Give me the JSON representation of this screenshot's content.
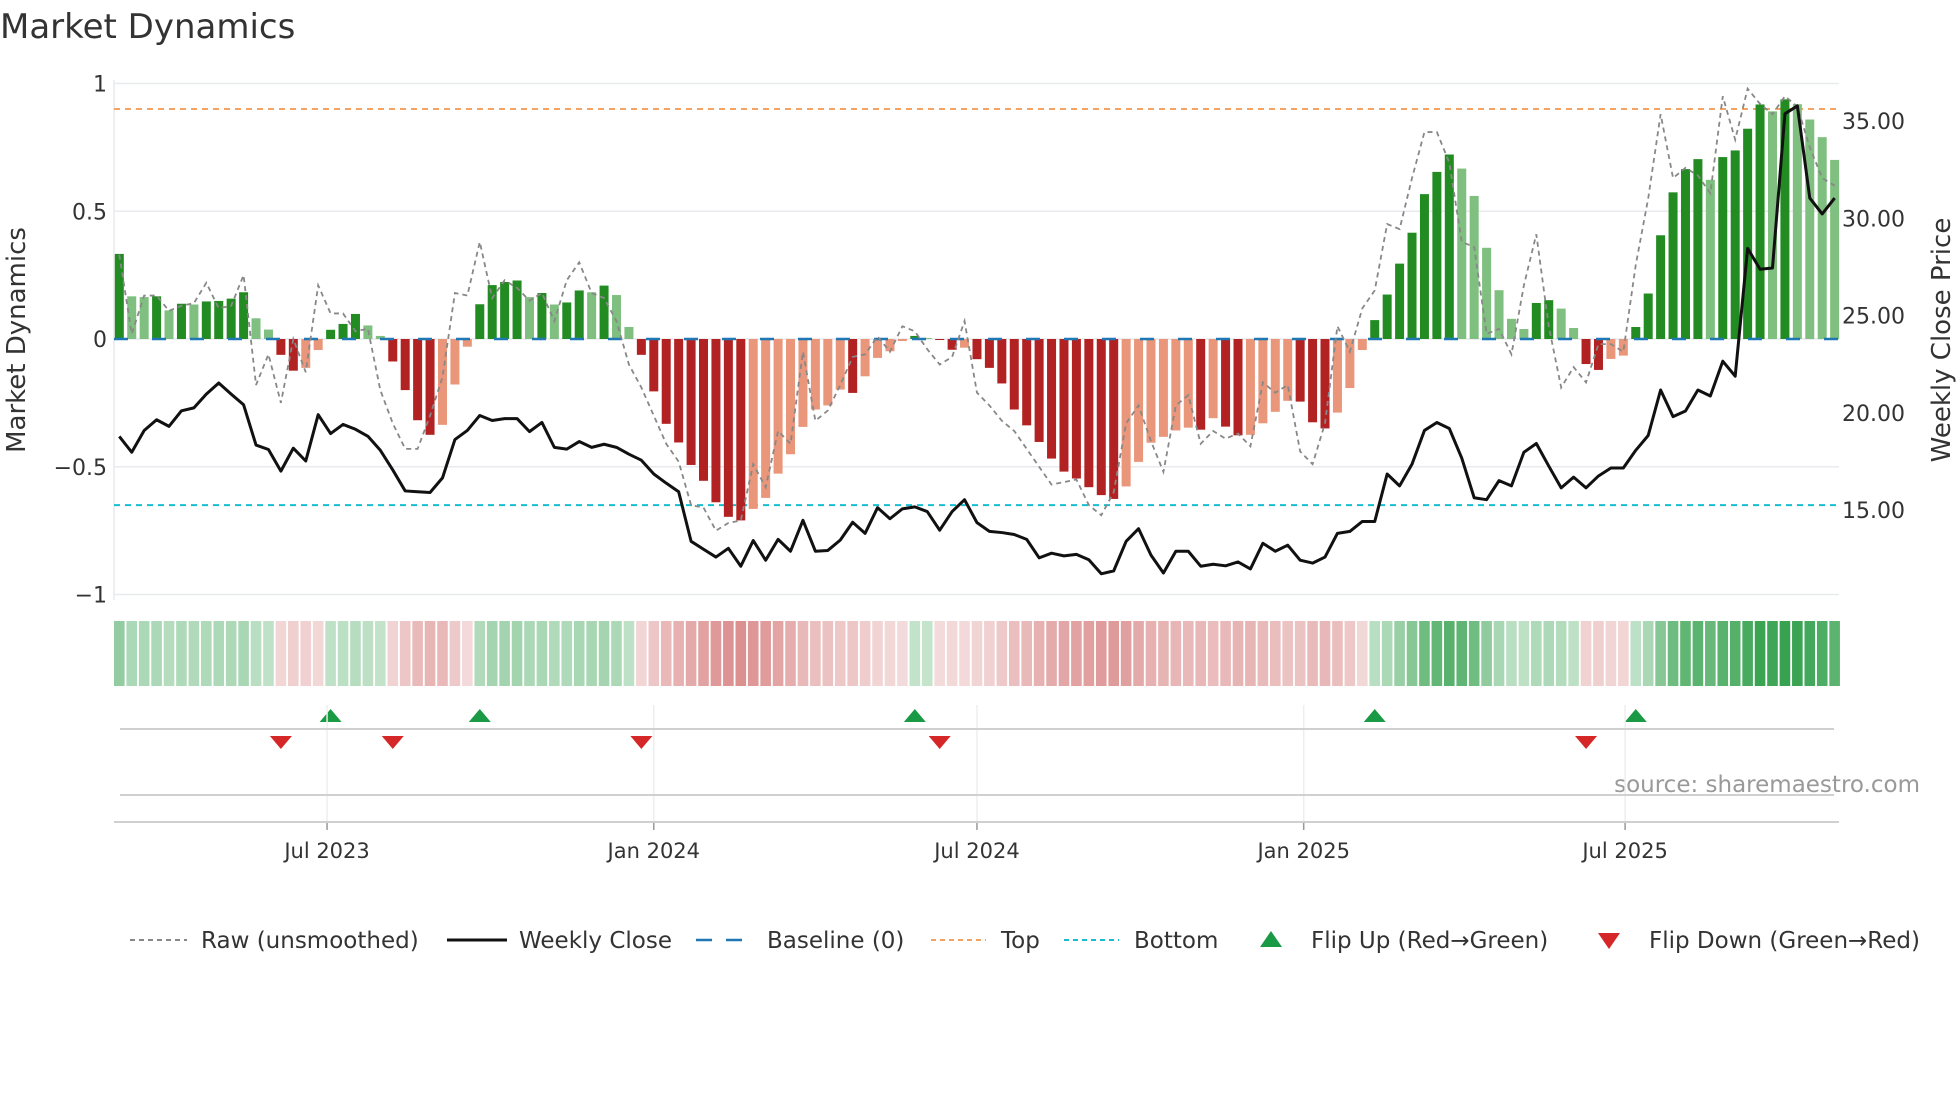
{
  "chart_data": {
    "type": "bar",
    "title": "Market Dynamics",
    "ylabel": "Market Dynamics",
    "y2label": "Weekly Close Price",
    "ylim": [
      -1,
      1
    ],
    "y2lim": [
      10.4,
      36.6
    ],
    "yticks": [
      "1",
      "0.5",
      "0",
      "−0.5",
      "−1"
    ],
    "ytick_values": [
      1,
      0.5,
      0,
      -0.5,
      -1
    ],
    "y2ticks": [
      "35.00",
      "30.00",
      "25.00",
      "20.00",
      "15.00"
    ],
    "y2tick_values": [
      35,
      30,
      25,
      20,
      15
    ],
    "xticks": [
      {
        "label": "Jul 2023",
        "date": "2023-07-01"
      },
      {
        "label": "Jan 2024",
        "date": "2024-01-01"
      },
      {
        "label": "Jul 2024",
        "date": "2024-07-01"
      },
      {
        "label": "Jan 2025",
        "date": "2025-01-01"
      },
      {
        "label": "Jul 2025",
        "date": "2025-07-01"
      }
    ],
    "start_date": "2023-03-06",
    "frequency": "weekly",
    "top_level": 0.9,
    "bottom_level": -0.65,
    "baseline": 0,
    "source": "source: sharemaestro.com",
    "series": [
      {
        "name": "Market Dynamics (smoothed)",
        "values": [
          0.333,
          0.167,
          0.164,
          0.167,
          0.112,
          0.138,
          0.135,
          0.147,
          0.149,
          0.158,
          0.183,
          0.081,
          0.037,
          -0.062,
          -0.124,
          -0.113,
          -0.043,
          0.036,
          0.059,
          0.098,
          0.053,
          0.012,
          -0.088,
          -0.2,
          -0.318,
          -0.375,
          -0.336,
          -0.178,
          -0.03,
          0.136,
          0.211,
          0.223,
          0.229,
          0.164,
          0.18,
          0.135,
          0.143,
          0.19,
          0.183,
          0.209,
          0.172,
          0.047,
          -0.062,
          -0.205,
          -0.332,
          -0.405,
          -0.493,
          -0.555,
          -0.639,
          -0.696,
          -0.71,
          -0.665,
          -0.622,
          -0.527,
          -0.451,
          -0.344,
          -0.276,
          -0.26,
          -0.198,
          -0.211,
          -0.146,
          -0.074,
          -0.048,
          -0.008,
          0.012,
          0.004,
          -0.004,
          -0.042,
          -0.034,
          -0.079,
          -0.113,
          -0.174,
          -0.276,
          -0.338,
          -0.403,
          -0.468,
          -0.519,
          -0.546,
          -0.58,
          -0.611,
          -0.626,
          -0.577,
          -0.481,
          -0.406,
          -0.383,
          -0.358,
          -0.347,
          -0.355,
          -0.31,
          -0.343,
          -0.377,
          -0.375,
          -0.33,
          -0.285,
          -0.242,
          -0.245,
          -0.326,
          -0.35,
          -0.288,
          -0.192,
          -0.043,
          0.074,
          0.174,
          0.295,
          0.416,
          0.567,
          0.654,
          0.722,
          0.667,
          0.56,
          0.357,
          0.191,
          0.079,
          0.039,
          0.141,
          0.152,
          0.119,
          0.043,
          -0.098,
          -0.121,
          -0.078,
          -0.065,
          0.047,
          0.178,
          0.406,
          0.574,
          0.665,
          0.704,
          0.623,
          0.712,
          0.738,
          0.823,
          0.918,
          0.891,
          0.938,
          0.919,
          0.859,
          0.79,
          0.701
        ]
      },
      {
        "name": "Raw (unsmoothed)",
        "values": [
          0.33,
          0.02,
          0.17,
          0.17,
          0.11,
          0.13,
          0.14,
          0.22,
          0.12,
          0.13,
          0.25,
          -0.18,
          -0.06,
          -0.25,
          0.0,
          -0.13,
          0.21,
          0.1,
          0.1,
          0.03,
          0.04,
          -0.2,
          -0.33,
          -0.43,
          -0.43,
          -0.3,
          -0.15,
          0.18,
          0.17,
          0.38,
          0.16,
          0.23,
          0.2,
          0.15,
          0.18,
          0.07,
          0.23,
          0.3,
          0.18,
          0.16,
          0.07,
          -0.1,
          -0.19,
          -0.3,
          -0.41,
          -0.48,
          -0.65,
          -0.66,
          -0.75,
          -0.72,
          -0.71,
          -0.49,
          -0.58,
          -0.36,
          -0.41,
          -0.05,
          -0.32,
          -0.28,
          -0.18,
          -0.07,
          -0.06,
          0.01,
          -0.05,
          0.05,
          0.03,
          -0.04,
          -0.1,
          -0.07,
          0.07,
          -0.21,
          -0.26,
          -0.32,
          -0.36,
          -0.43,
          -0.5,
          -0.57,
          -0.56,
          -0.55,
          -0.65,
          -0.69,
          -0.6,
          -0.33,
          -0.26,
          -0.4,
          -0.52,
          -0.26,
          -0.22,
          -0.41,
          -0.36,
          -0.39,
          -0.37,
          -0.42,
          -0.17,
          -0.21,
          -0.18,
          -0.44,
          -0.49,
          -0.33,
          0.05,
          -0.05,
          0.12,
          0.19,
          0.45,
          0.43,
          0.63,
          0.81,
          0.81,
          0.69,
          0.38,
          0.36,
          0.02,
          0.04,
          -0.06,
          0.21,
          0.41,
          0.05,
          -0.19,
          -0.11,
          -0.17,
          -0.02,
          -0.02,
          -0.05,
          0.29,
          0.55,
          0.88,
          0.63,
          0.67,
          0.64,
          0.57,
          0.95,
          0.78,
          0.98,
          0.92,
          0.88,
          0.95,
          0.91,
          0.75,
          0.63,
          0.6
        ]
      },
      {
        "name": "Weekly Close",
        "values": [
          18.78,
          17.97,
          19.09,
          19.64,
          19.3,
          20.1,
          20.25,
          20.96,
          21.53,
          20.96,
          20.41,
          18.34,
          18.11,
          17.0,
          18.18,
          17.52,
          19.9,
          18.93,
          19.4,
          19.15,
          18.79,
          18.07,
          17.06,
          15.98,
          15.94,
          15.9,
          16.65,
          18.62,
          19.09,
          19.86,
          19.6,
          19.7,
          19.7,
          19.03,
          19.5,
          18.22,
          18.13,
          18.52,
          18.22,
          18.38,
          18.22,
          17.87,
          17.56,
          16.85,
          16.38,
          15.94,
          13.39,
          12.98,
          12.58,
          13.03,
          12.11,
          13.43,
          12.42,
          13.49,
          12.88,
          14.47,
          12.88,
          12.92,
          13.45,
          14.37,
          13.8,
          15.12,
          14.55,
          15.06,
          15.16,
          14.92,
          13.96,
          14.92,
          15.53,
          14.35,
          13.9,
          13.84,
          13.74,
          13.49,
          12.54,
          12.78,
          12.64,
          12.72,
          12.44,
          11.72,
          11.87,
          13.39,
          14.04,
          12.68,
          11.76,
          12.88,
          12.88,
          12.11,
          12.21,
          12.13,
          12.33,
          11.97,
          13.29,
          12.88,
          13.19,
          12.42,
          12.27,
          12.58,
          13.8,
          13.9,
          14.41,
          14.41,
          16.85,
          16.24,
          17.36,
          19.09,
          19.5,
          19.19,
          17.67,
          15.63,
          15.53,
          16.51,
          16.24,
          17.97,
          18.42,
          17.26,
          16.14,
          16.69,
          16.14,
          16.75,
          17.16,
          17.16,
          18.07,
          18.83,
          21.17,
          19.8,
          20.09,
          21.17,
          20.86,
          22.65,
          21.88,
          28.45,
          27.38,
          27.44,
          35.37,
          35.78,
          31.04,
          30.22,
          31.04
        ]
      }
    ],
    "legend": {
      "placement": "bottom",
      "items": [
        "Raw (unsmoothed)",
        "Weekly Close",
        "Baseline (0)",
        "Top",
        "Bottom",
        "Flip Up (Red→Green)",
        "Flip Down (Green→Red)"
      ]
    },
    "colors": {
      "pos_rising": "#228b22",
      "pos_falling": "#7fbf7f",
      "neg_falling": "#b22222",
      "neg_rising": "#e9967a",
      "raw": "#888888",
      "close": "#111111",
      "baseline": "#1f77b4",
      "top": "#f4a460",
      "bottom": "#17becf",
      "flip_up": "#1a9a45",
      "flip_down": "#d62728",
      "strip_green": "#2e9e48",
      "strip_red": "#c85050"
    }
  }
}
